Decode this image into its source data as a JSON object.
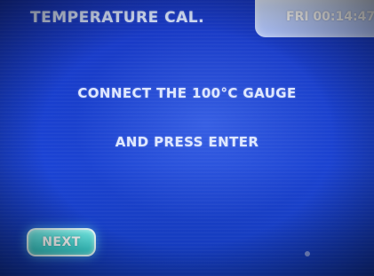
{
  "header": {
    "title": "TEMPERATURE CAL.",
    "clock": "FRI 00:14:47"
  },
  "message": {
    "line1": "CONNECT THE 100°C GAUGE",
    "line2": "AND PRESS ENTER"
  },
  "buttons": {
    "next": "NEXT"
  },
  "colors": {
    "screen_blue": "#1b44d8",
    "clock_tab": "#d7e4ff",
    "button_cyan": "#2dc7c6",
    "text": "#dfe8ff"
  }
}
